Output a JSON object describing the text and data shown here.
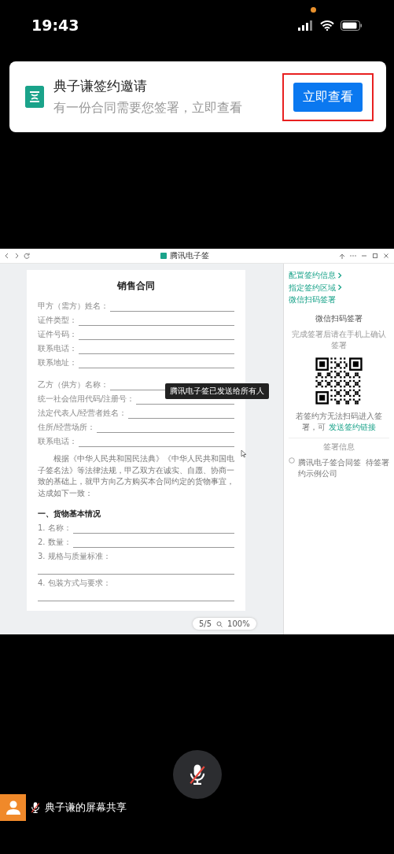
{
  "status_bar": {
    "time": "19:43"
  },
  "notification": {
    "title": "典子谦签约邀请",
    "message": "有一份合同需要您签署，立即查看",
    "button": "立即查看",
    "highlighted": true
  },
  "shared_screen": {
    "window_title": "腾讯电子签",
    "document": {
      "title": "销售合同",
      "party_a_fields": [
        "甲方（需方）姓名：",
        "证件类型：",
        "证件号码：",
        "联系电话：",
        "联系地址："
      ],
      "party_b_fields": [
        "乙方（供方）名称：",
        "统一社会信用代码/注册号：",
        "法定代表人/经营者姓名：",
        "住所/经营场所：",
        "联系电话："
      ],
      "paragraph": "根据《中华人民共和国民法典》《中华人民共和国电子签名法》等法律法规，甲乙双方在诚实、自愿、协商一致的基础上，就甲方向乙方购买本合同约定的货物事宜，达成如下一致：",
      "section_heading": "一、货物基本情况",
      "items": [
        {
          "label": "1. 名称：",
          "kind": "inline"
        },
        {
          "label": "2. 数量：",
          "kind": "inline"
        },
        {
          "label": "3. 规格与质量标准：",
          "kind": "block"
        },
        {
          "label": "4. 包装方式与要求：",
          "kind": "block"
        }
      ]
    },
    "tooltip": "腾讯电子签已发送给所有人",
    "pager": {
      "page": "5/5",
      "zoom": "100%"
    },
    "side_panel": {
      "breadcrumb": [
        "配置签约信息",
        "指定签约区域",
        "微信扫码签署"
      ],
      "heading": "微信扫码签署",
      "hint": "完成签署后请在手机上确认签署",
      "link_sentence": "若签约方无法扫码进入签署，可",
      "link": "发送签约链接",
      "section": "签署信息",
      "signer": "腾讯电子签合同签约示例公司",
      "signer_status": "待签署"
    }
  },
  "mic": {
    "muted": true
  },
  "share_label": {
    "name": "典子谦的屏幕共享",
    "muted": true
  }
}
